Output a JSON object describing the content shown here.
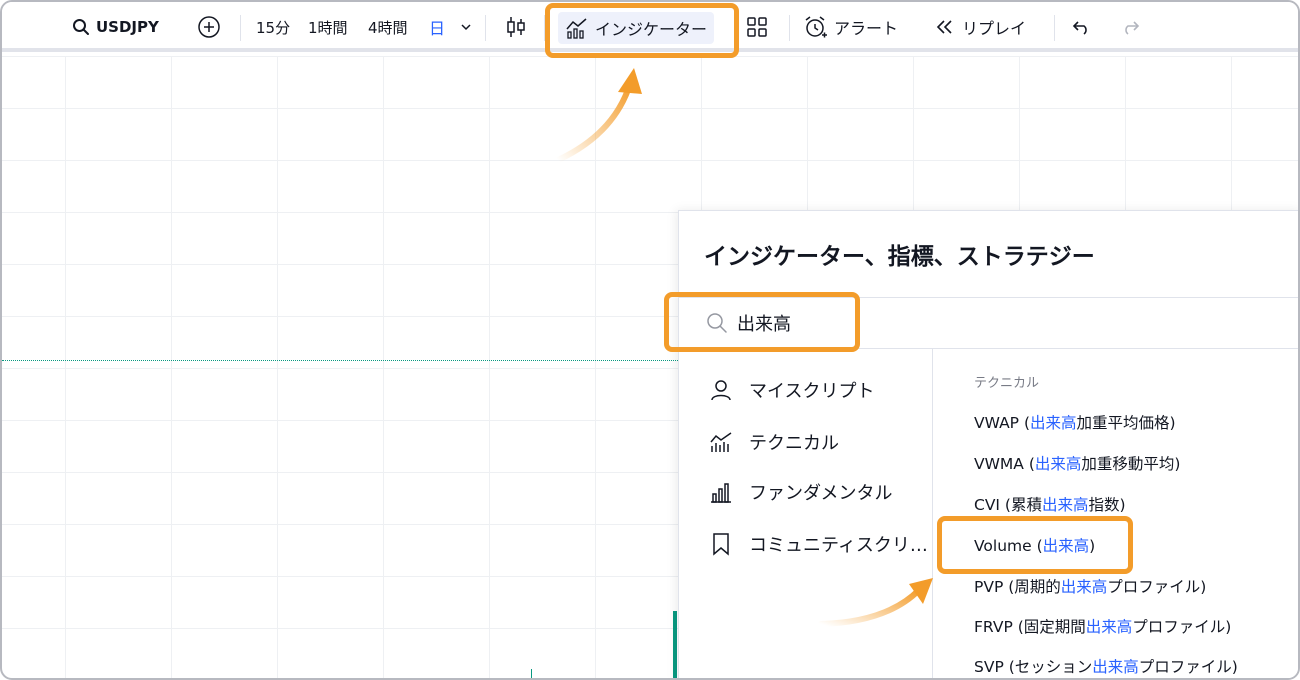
{
  "toolbar": {
    "symbol": "USDJPY",
    "timeframes": [
      "15分",
      "1時間",
      "4時間",
      "日"
    ],
    "indicators_label": "インジケーター",
    "alert_label": "アラート",
    "replay_label": "リプレイ",
    "active_color": "#2962ff"
  },
  "dialog": {
    "title": "インジケーター、指標、ストラテジー",
    "search_value": "出来高",
    "categories": [
      {
        "label": "マイスクリプト",
        "icon": "user-icon"
      },
      {
        "label": "テクニカル",
        "icon": "technical-chart-icon"
      },
      {
        "label": "ファンダメンタル",
        "icon": "bar-chart-icon"
      },
      {
        "label": "コミュニティスクリ…",
        "icon": "bookmark-icon"
      }
    ],
    "section_header": "テクニカル",
    "results": [
      {
        "pre": "VWAP (",
        "hl": "出来高",
        "post": "加重平均価格)"
      },
      {
        "pre": "VWMA (",
        "hl": "出来高",
        "post": "加重移動平均)"
      },
      {
        "pre": "CVI (累積",
        "hl": "出来高",
        "post": "指数)"
      },
      {
        "pre": "Volume (",
        "hl": "出来高",
        "post": ")"
      },
      {
        "pre": "PVP (周期的",
        "hl": "出来高",
        "post": "プロファイル)"
      },
      {
        "pre": "FRVP (固定期間",
        "hl": "出来高",
        "post": "プロファイル)"
      },
      {
        "pre": "SVP (セッション",
        "hl": "出来高",
        "post": "プロファイル)"
      }
    ]
  },
  "colors": {
    "highlight_box": "#f39c2a",
    "match_text": "#2962ff",
    "bull": "#089981"
  }
}
